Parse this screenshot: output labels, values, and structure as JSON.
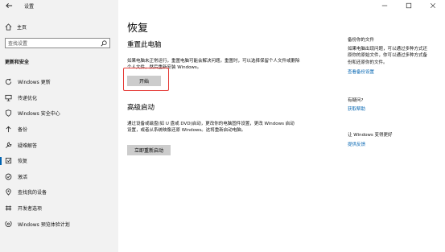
{
  "window": {
    "title": "设置"
  },
  "sidebar": {
    "home_label": "主页",
    "search_placeholder": "查找设置",
    "section_title": "更新和安全",
    "items": [
      {
        "label": "Windows 更新",
        "icon": "refresh-icon"
      },
      {
        "label": "传递优化",
        "icon": "delivery-icon"
      },
      {
        "label": "Windows 安全中心",
        "icon": "shield-icon"
      },
      {
        "label": "备份",
        "icon": "backup-arrow-icon"
      },
      {
        "label": "疑难解答",
        "icon": "wrench-icon"
      },
      {
        "label": "恢复",
        "icon": "recovery-icon",
        "active": true
      },
      {
        "label": "激活",
        "icon": "activation-check-icon"
      },
      {
        "label": "查找我的设备",
        "icon": "find-device-icon"
      },
      {
        "label": "开发者选项",
        "icon": "developer-icon"
      },
      {
        "label": "Windows 预览体验计划",
        "icon": "insider-icon"
      }
    ]
  },
  "main": {
    "page_title": "恢复",
    "reset": {
      "heading": "重置此电脑",
      "description": "如果电脑未正常运行，重置电脑可能会解决问题。重置时，可以选择保留个人文件或删除个人文件，然后重新安装 Windows。",
      "button": "开始"
    },
    "advanced": {
      "heading": "高级启动",
      "description": "通过设备或磁盘(如 U 盘或 DVD)启动，更改你的电脑固件设置，更改 Windows 启动设置，或者从系统映像还原 Windows。这将重新启动电脑。",
      "button": "立即重新启动"
    }
  },
  "right": {
    "backup": {
      "title": "备份你的文件",
      "text": "如果电脑出现问题，可以通过多种方式还原你的原始文件，你可以通过多种方式备份和还原你的文件。",
      "link": "查看备份设置"
    },
    "help": {
      "title": "有疑问?",
      "link": "获取帮助"
    },
    "feedback": {
      "title": "让 Windows 变得更好",
      "link": "提供反馈"
    }
  },
  "colors": {
    "accent": "#0063b1",
    "sidebar_bg": "#f2f2f2",
    "button_bg": "#cccccc",
    "highlight": "#e53935"
  }
}
